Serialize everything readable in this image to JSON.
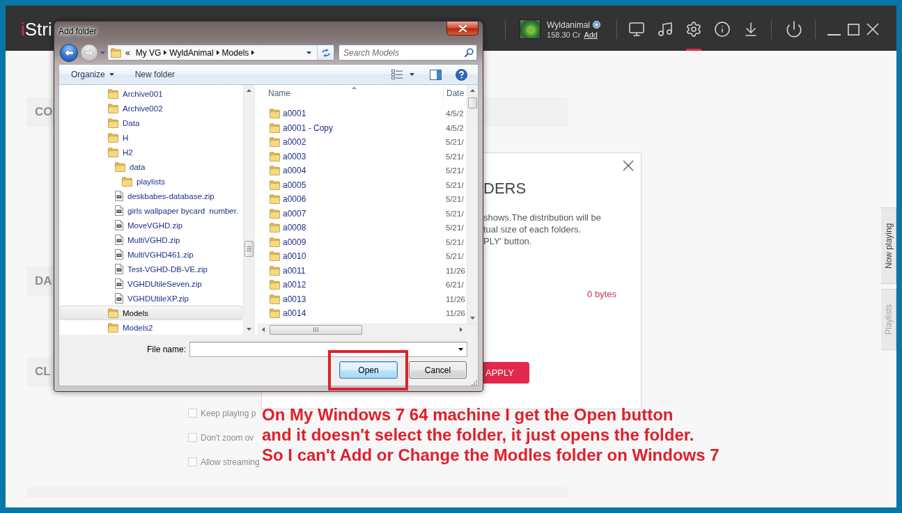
{
  "app_bar": {
    "logo": {
      "accent": "i",
      "rest": "Stri"
    },
    "user": {
      "name": "Wyldanimal",
      "verified": true,
      "credits": "158.30 Cr",
      "add_link": "Add"
    },
    "nav_icons": [
      {
        "kind": "monitor",
        "selected": false
      },
      {
        "kind": "music",
        "selected": false
      },
      {
        "kind": "settings",
        "selected": true
      },
      {
        "kind": "info",
        "selected": false
      },
      {
        "kind": "download",
        "selected": false
      }
    ],
    "session_controls": [
      {
        "kind": "power"
      }
    ],
    "window_controls": [
      {
        "kind": "minimize"
      },
      {
        "kind": "maximize"
      },
      {
        "kind": "close"
      }
    ]
  },
  "settings_sections": [
    {
      "title": "CO"
    },
    {
      "title": "DA"
    },
    {
      "title": "CL",
      "options": [
        {
          "label": "Keep playing p",
          "checked": false
        },
        {
          "label": "Don't zoom ov",
          "checked": false
        },
        {
          "label": "Allow streaming",
          "checked": false
        }
      ]
    }
  ],
  "side_tabs": [
    {
      "label": "Now playing",
      "selected": true
    },
    {
      "label": "Playlists",
      "selected": false
    }
  ],
  "folders_modal": {
    "title": "DERS",
    "description": [
      "shows.The distribution will be",
      "tual size of each folders.",
      "PLY' button."
    ],
    "total_size": "0 bytes",
    "apply_button": "APPLY"
  },
  "add_folder_dialog": {
    "title": "Add folder",
    "history_buttons": [
      {
        "kind": "back",
        "disabled": false
      },
      {
        "kind": "forward",
        "disabled": true
      }
    ],
    "address": {
      "overflow": "«",
      "segments": [
        "My VG",
        "WyldAnimal",
        "Models"
      ]
    },
    "search": {
      "placeholder": "Search Models"
    },
    "commands": [
      {
        "label": "Organize",
        "has_menu": true
      },
      {
        "label": "New folder",
        "has_menu": false
      }
    ],
    "tree": [
      {
        "label": "Archive001",
        "kind": "folder",
        "selected": false
      },
      {
        "label": "Archive002",
        "kind": "folder",
        "selected": false
      },
      {
        "label": "Data",
        "kind": "folder",
        "selected": false
      },
      {
        "label": "H",
        "kind": "folder",
        "selected": false
      },
      {
        "label": "H2",
        "kind": "folder",
        "selected": false,
        "children": [
          {
            "label": "data",
            "kind": "folder",
            "selected": false,
            "children": [
              {
                "label": "playlists",
                "kind": "folder",
                "selected": false
              }
            ]
          },
          {
            "label": "deskbabes-database.zip",
            "kind": "zip",
            "selected": false
          },
          {
            "label": "girls wallpaper bycard  number.",
            "kind": "zip",
            "selected": false
          },
          {
            "label": "MoveVGHD.zip",
            "kind": "zip",
            "selected": false
          },
          {
            "label": "MultiVGHD.zip",
            "kind": "zip",
            "selected": false
          },
          {
            "label": "MultiVGHD461.zip",
            "kind": "zip",
            "selected": false
          },
          {
            "label": "Test-VGHD-DB-VE.zip",
            "kind": "zip",
            "selected": false
          },
          {
            "label": "VGHDUtileSeven.zip",
            "kind": "zip",
            "selected": false
          },
          {
            "label": "VGHDUtileXP.zip",
            "kind": "zip",
            "selected": false
          }
        ]
      },
      {
        "label": "Models",
        "kind": "folder",
        "selected": true
      },
      {
        "label": "Models2",
        "kind": "folder",
        "selected": false
      }
    ],
    "columns": [
      {
        "label": "Name",
        "sorted": true
      },
      {
        "label": "Date",
        "sorted": false
      }
    ],
    "rows": [
      {
        "name": "a0001",
        "date": "4/5/2"
      },
      {
        "name": "a0001 - Copy",
        "date": "4/5/2"
      },
      {
        "name": "a0002",
        "date": "5/21/"
      },
      {
        "name": "a0003",
        "date": "5/21/"
      },
      {
        "name": "a0004",
        "date": "5/21/"
      },
      {
        "name": "a0005",
        "date": "5/21/"
      },
      {
        "name": "a0006",
        "date": "5/21/"
      },
      {
        "name": "a0007",
        "date": "5/21/"
      },
      {
        "name": "a0008",
        "date": "5/21/"
      },
      {
        "name": "a0009",
        "date": "5/21/"
      },
      {
        "name": "a0010",
        "date": "5/21/"
      },
      {
        "name": "a0011",
        "date": "11/26"
      },
      {
        "name": "a0012",
        "date": "6/21/"
      },
      {
        "name": "a0013",
        "date": "11/26"
      },
      {
        "name": "a0014",
        "date": "11/26"
      }
    ],
    "file_name_label": "File name:",
    "buttons": [
      {
        "label": "Open",
        "default": true
      },
      {
        "label": "Cancel",
        "default": false
      }
    ]
  },
  "annotation": {
    "lines": [
      "On My Windows 7 64 machine I get the Open button",
      "and it doesn't select the folder, it just opens the folder.",
      "So I can't Add or Change the Modles folder on Windows 7"
    ]
  }
}
